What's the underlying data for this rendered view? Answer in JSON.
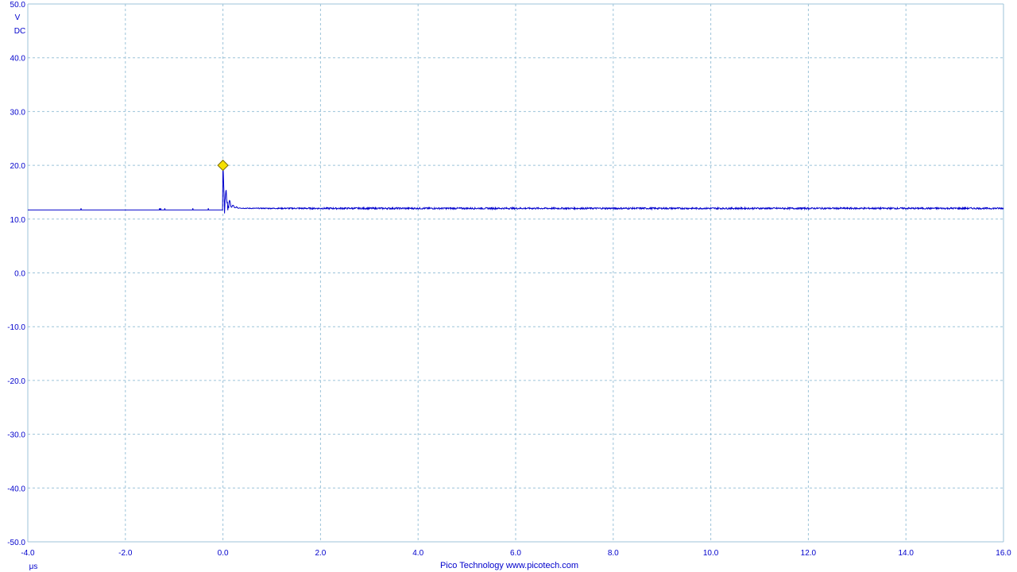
{
  "chart_data": {
    "type": "line",
    "title": "",
    "xlabel": "μs",
    "ylabel_unit": "V",
    "ylabel_coupling": "DC",
    "xlim": [
      -4.0,
      16.0
    ],
    "ylim": [
      -50.0,
      50.0
    ],
    "x_ticks": [
      "-4.0",
      "-2.0",
      "0.0",
      "2.0",
      "4.0",
      "6.0",
      "8.0",
      "10.0",
      "12.0",
      "14.0",
      "16.0"
    ],
    "y_ticks": [
      "50.0",
      "40.0",
      "30.0",
      "20.0",
      "10.0",
      "0.0",
      "-10.0",
      "-20.0",
      "-30.0",
      "-40.0",
      "-50.0"
    ],
    "grid": true,
    "series": [
      {
        "color": "#0000cc",
        "baseline_pre_trigger": 11.7,
        "baseline_post_trigger": 12.0,
        "trigger_x": 0.0,
        "peak": 20.0,
        "noise_amplitude": 0.3
      }
    ],
    "trigger_marker": {
      "x": 0.0,
      "y": 20.0,
      "color": "#f5e000"
    }
  },
  "footer": {
    "text": "Pico Technology  www.picotech.com"
  },
  "colors": {
    "axis_text": "#0000cc",
    "grid": "#9cc3d9",
    "trace": "#0000cc"
  }
}
